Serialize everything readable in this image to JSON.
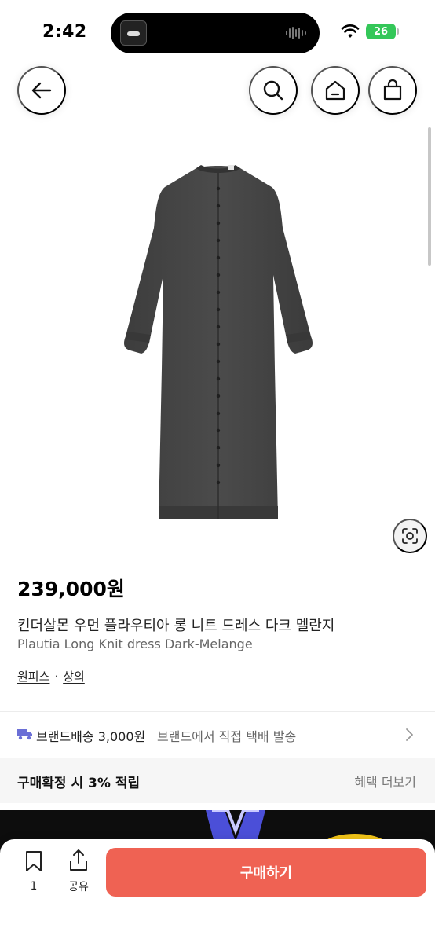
{
  "status_bar": {
    "time": "2:42",
    "battery": "26"
  },
  "nav": {
    "back_icon": "arrow-left-icon",
    "search_icon": "search-icon",
    "home_icon": "home-icon",
    "cart_icon": "shopping-bag-icon"
  },
  "product": {
    "image_alt": "dark melange long knit dress",
    "price": "239,000원",
    "title_ko": "킨더살몬 우먼 플라우티아 롱 니트 드레스 다크 멜란지",
    "title_en": "Plautia Long Knit dress Dark-Melange",
    "categories": [
      "원피스",
      "상의"
    ],
    "category_separator": "·"
  },
  "shipping": {
    "label": "브랜드배송",
    "price": "3,000원",
    "description": "브랜드에서 직접 택배 발송"
  },
  "benefit": {
    "text": "구매확정 시 3% 적립",
    "more_label": "혜택 더보기"
  },
  "bottom_bar": {
    "bookmark_count": "1",
    "share_label": "공유",
    "buy_label": "구매하기"
  },
  "colors": {
    "accent": "#ef6253",
    "truck": "#6b6fd6",
    "battery": "#34c759"
  }
}
